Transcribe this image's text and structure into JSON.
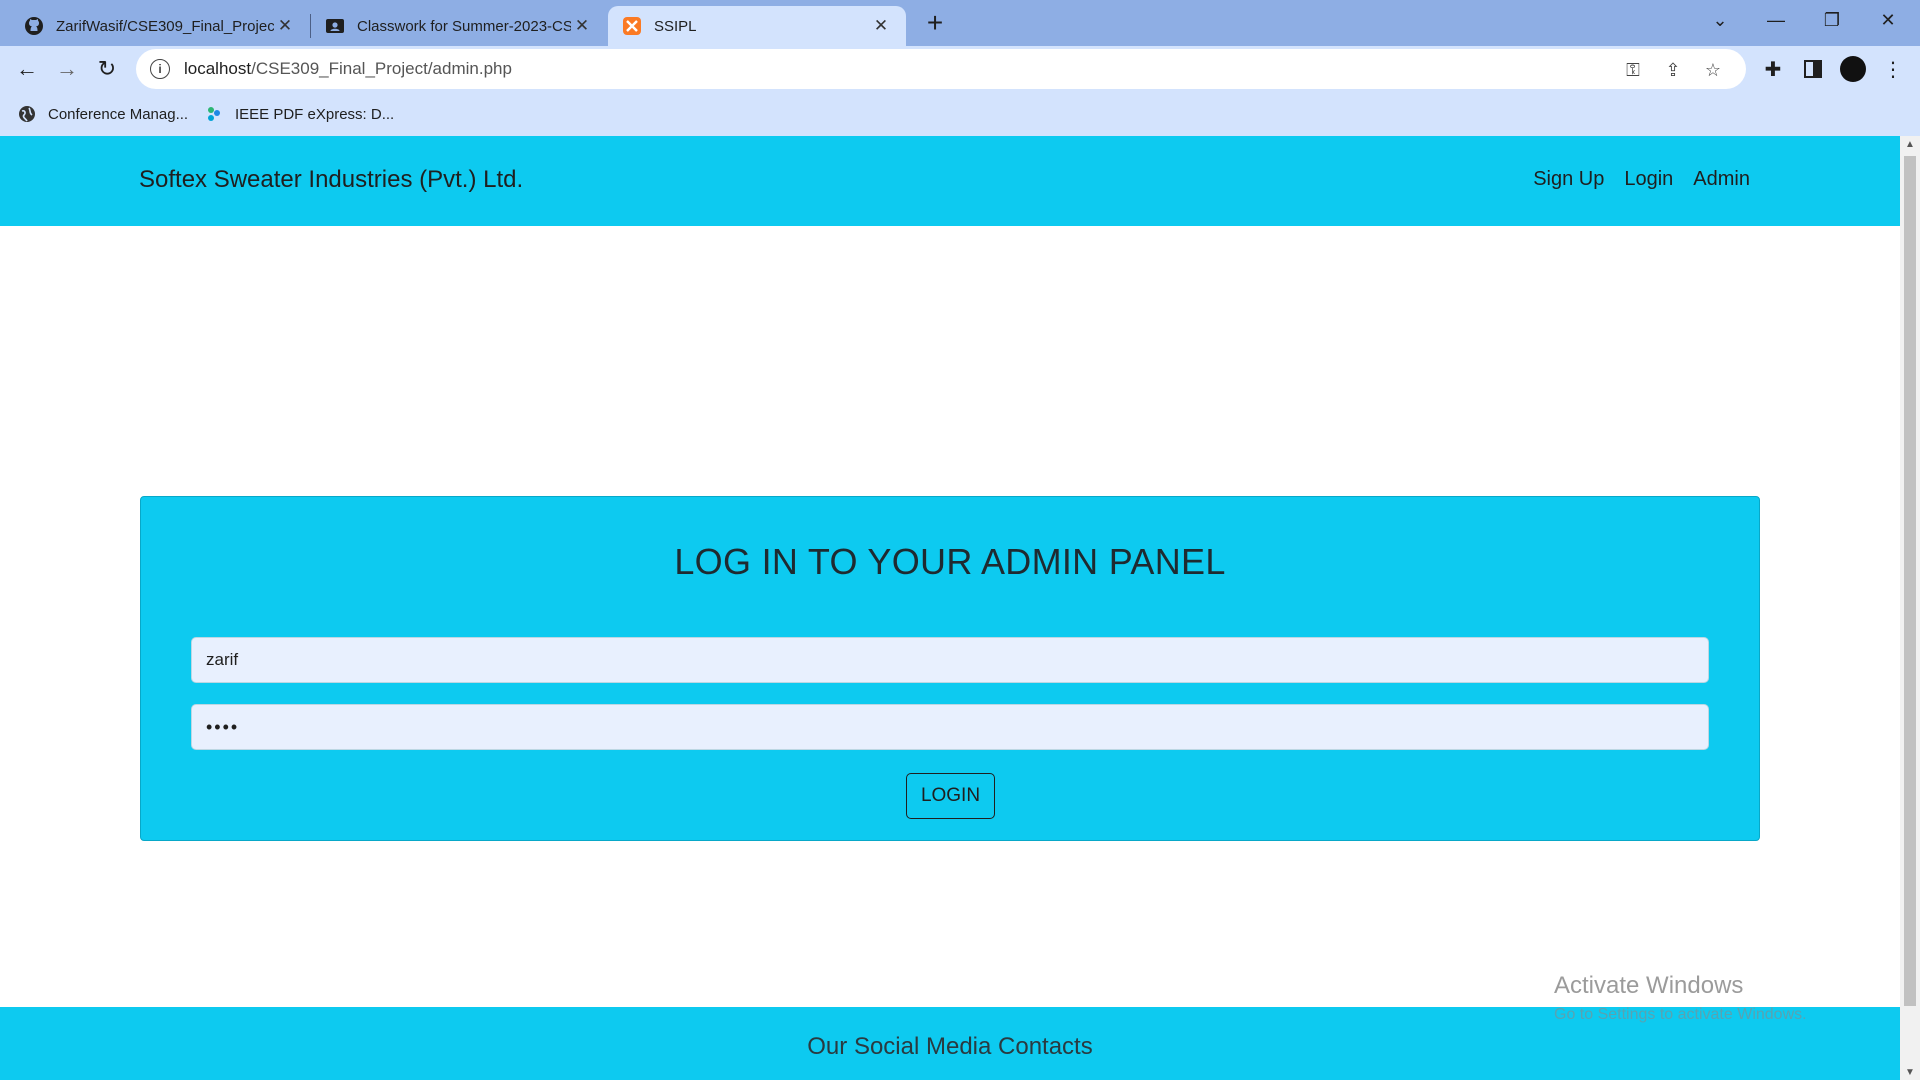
{
  "browser": {
    "tabs": [
      {
        "title": "ZarifWasif/CSE309_Final_Project",
        "icon": "github-icon",
        "active": false
      },
      {
        "title": "Classwork for Summer-2023-CSE",
        "icon": "classroom-icon",
        "active": false
      },
      {
        "title": "SSIPL",
        "icon": "xampp-icon",
        "active": true
      }
    ],
    "url_host": "localhost",
    "url_path": "/CSE309_Final_Project/admin.php",
    "bookmarks": [
      {
        "label": "Conference Manag...",
        "icon": "globe-icon"
      },
      {
        "label": "IEEE PDF eXpress: D...",
        "icon": "ieee-icon"
      }
    ]
  },
  "site": {
    "brand": "Softex Sweater Industries (Pvt.) Ltd.",
    "nav": {
      "signup": "Sign Up",
      "login": "Login",
      "admin": "Admin"
    },
    "login_card": {
      "title": "LOG IN TO YOUR ADMIN PANEL",
      "username_value": "zarif",
      "password_value": "••••",
      "button_label": "LOGIN"
    },
    "footer": {
      "heading": "Our Social Media Contacts"
    }
  },
  "watermark": {
    "line1": "Activate Windows",
    "line2": "Go to Settings to activate Windows."
  },
  "colors": {
    "accent": "#0dcaf0",
    "chrome_tabstrip": "#8eaee4",
    "chrome_toolbar": "#d3e3fd"
  }
}
